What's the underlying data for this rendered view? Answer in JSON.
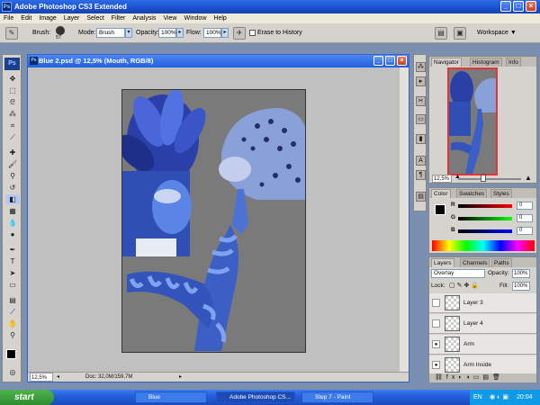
{
  "app": {
    "title": "Adobe Photoshop CS3 Extended",
    "logo": "Ps"
  },
  "menu": [
    "File",
    "Edit",
    "Image",
    "Layer",
    "Select",
    "Filter",
    "Analysis",
    "View",
    "Window",
    "Help"
  ],
  "options": {
    "brush_label": "Brush:",
    "brush_size": "57",
    "mode_label": "Mode:",
    "mode_value": "Brush",
    "opacity_label": "Opacity:",
    "opacity_value": "100%",
    "flow_label": "Flow:",
    "flow_value": "100%",
    "erase_history": "Erase to History",
    "workspace": "Workspace ▼"
  },
  "document": {
    "title": "Blue 2.psd @ 12,5% (Mouth, RGB/8)",
    "zoom": "12,5%",
    "doc_info": "Doc: 32,0M/159,7M"
  },
  "navigator": {
    "tabs": [
      "Navigator",
      "Histogram",
      "Info"
    ],
    "zoom": "12,5%"
  },
  "color_panel": {
    "tabs": [
      "Color",
      "Swatches",
      "Styles"
    ],
    "r_label": "R",
    "g_label": "G",
    "b_label": "B",
    "r": "0",
    "g": "0",
    "b": "0"
  },
  "layers_panel": {
    "tabs": [
      "Layers",
      "Channels",
      "Paths"
    ],
    "blend_mode": "Overlay",
    "opacity_label": "Opacity:",
    "opacity": "100%",
    "lock_label": "Lock:",
    "fill_label": "Fill:",
    "fill": "100%",
    "layers": [
      {
        "name": "Layer 3",
        "visible": false
      },
      {
        "name": "Layer 4",
        "visible": false
      },
      {
        "name": "Arm",
        "visible": true
      },
      {
        "name": "Arm Inside",
        "visible": true
      }
    ]
  },
  "taskbar": {
    "start": "start",
    "tasks": [
      "Blue",
      "Adobe Photoshop CS...",
      "Step 7 - Paint"
    ],
    "lang": "EN",
    "time": "20:04"
  },
  "colors": {
    "accent": "#245edb",
    "canvas": "#7a7a7a"
  }
}
